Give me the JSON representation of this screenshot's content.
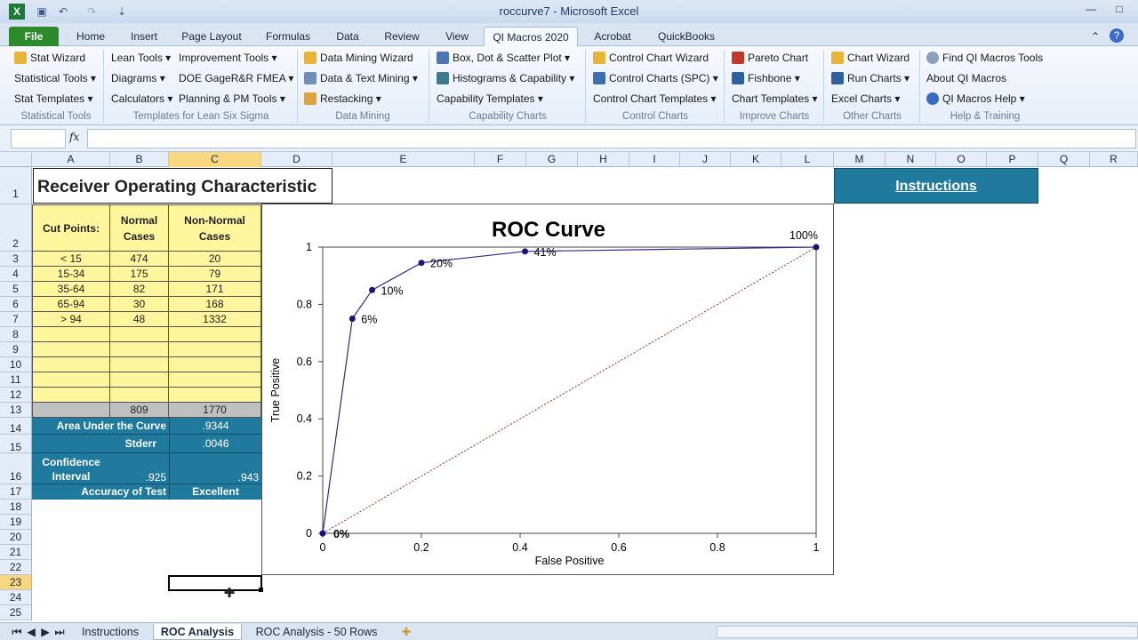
{
  "window": {
    "title": "roccurve7  -  Microsoft Excel",
    "min": "—",
    "max": "□",
    "close": "✕",
    "ribbon_min": "⌃",
    "help": "?"
  },
  "qat": {
    "excel_icon": "X",
    "save": "▣",
    "undo": "↶",
    "redo": "↷",
    "custom": "⇣"
  },
  "tabs": [
    "File",
    "Home",
    "Insert",
    "Page Layout",
    "Formulas",
    "Data",
    "Review",
    "View",
    "QI Macros 2020",
    "Acrobat",
    "QuickBooks"
  ],
  "ribbon": {
    "statistical_tools": {
      "items": [
        "Stat Wizard",
        "Statistical Tools",
        "Stat Templates"
      ],
      "label": "Statistical Tools"
    },
    "lean": {
      "items": [
        "Lean Tools",
        "Diagrams",
        "Calculators",
        "Improvement Tools",
        "DOE GageR&R FMEA",
        "Planning & PM Tools"
      ],
      "label": "Templates for Lean Six Sigma"
    },
    "data_mining": {
      "items": [
        "Data Mining Wizard",
        "Data & Text Mining",
        "Restacking"
      ],
      "label": "Data Mining"
    },
    "capability": {
      "items": [
        "Box, Dot & Scatter Plot",
        "Histograms & Capability",
        "Capability Templates"
      ],
      "label": "Capability Charts"
    },
    "control": {
      "items": [
        "Control Chart Wizard",
        "Control Charts (SPC)",
        "Control Chart Templates"
      ],
      "label": "Control Charts"
    },
    "improve": {
      "items": [
        "Pareto Chart",
        "Fishbone",
        "Chart Templates"
      ],
      "label": "Improve Charts"
    },
    "other": {
      "items": [
        "Chart Wizard",
        "Run Charts",
        "Excel Charts"
      ],
      "label": "Other Charts"
    },
    "help": {
      "items": [
        "Find QI Macros Tools",
        "About QI Macros",
        "QI Macros Help"
      ],
      "label": "Help & Training"
    }
  },
  "formula_bar": {
    "fx": "fx",
    "value": ""
  },
  "columns": [
    "A",
    "B",
    "C",
    "D",
    "E",
    "F",
    "G",
    "H",
    "I",
    "J",
    "K",
    "L",
    "M",
    "N",
    "O",
    "P",
    "Q",
    "R"
  ],
  "rows": [
    "1",
    "2",
    "3",
    "4",
    "5",
    "6",
    "7",
    "8",
    "9",
    "10",
    "11",
    "12",
    "13",
    "14",
    "15",
    "16",
    "17",
    "18",
    "19",
    "20",
    "21",
    "22",
    "23",
    "24",
    "25"
  ],
  "sheet": {
    "title": "Receiver Operating Characteristic",
    "instructions": "Instructions",
    "headers": {
      "cut_points": "Cut Points:",
      "normal": "Normal Cases",
      "non_normal": "Non-Normal Cases"
    },
    "data": [
      [
        "< 15",
        "474",
        "20"
      ],
      [
        "15-34",
        "175",
        "79"
      ],
      [
        "35-64",
        "82",
        "171"
      ],
      [
        "65-94",
        "30",
        "168"
      ],
      [
        "> 94",
        "48",
        "1332"
      ]
    ],
    "totals": {
      "normal": "809",
      "non_normal": "1770"
    },
    "auc_label": "Area Under the Curve",
    "auc": ".9344",
    "stderr_label": "Stderr",
    "stderr": ".0046",
    "ci_label": "Confidence Interval",
    "ci_low": ".925",
    "ci_high": ".943",
    "accuracy_label": "Accuracy of Test",
    "accuracy": "Excellent"
  },
  "chart_data": {
    "type": "line",
    "title": "ROC Curve",
    "xlabel": "False Positive",
    "ylabel": "True Positive",
    "xlim": [
      0,
      1
    ],
    "ylim": [
      0,
      1
    ],
    "xticks": [
      "0",
      "0.2",
      "0.4",
      "0.6",
      "0.8",
      "1"
    ],
    "yticks": [
      "0",
      "0.2",
      "0.4",
      "0.6",
      "0.8",
      "1"
    ],
    "series": [
      {
        "x": [
          0,
          0.06,
          0.1,
          0.2,
          0.41,
          1
        ],
        "y": [
          0,
          0.75,
          0.85,
          0.945,
          0.985,
          1
        ],
        "labels": [
          "0%",
          "6%",
          "10%",
          "20%",
          "41%",
          "100%"
        ],
        "color": "#2b2b8a"
      },
      {
        "x": [
          0,
          1
        ],
        "y": [
          0,
          1
        ],
        "color": "#b22222",
        "style": "dotted"
      }
    ]
  },
  "sheet_tabs": [
    "Instructions",
    "ROC Analysis",
    "ROC Analysis - 50 Rows"
  ],
  "active_sheet": "ROC Analysis",
  "nav": {
    "first": "⏮",
    "prev": "◀",
    "next": "▶",
    "last": "⏭",
    "new_sheet": "✚"
  }
}
